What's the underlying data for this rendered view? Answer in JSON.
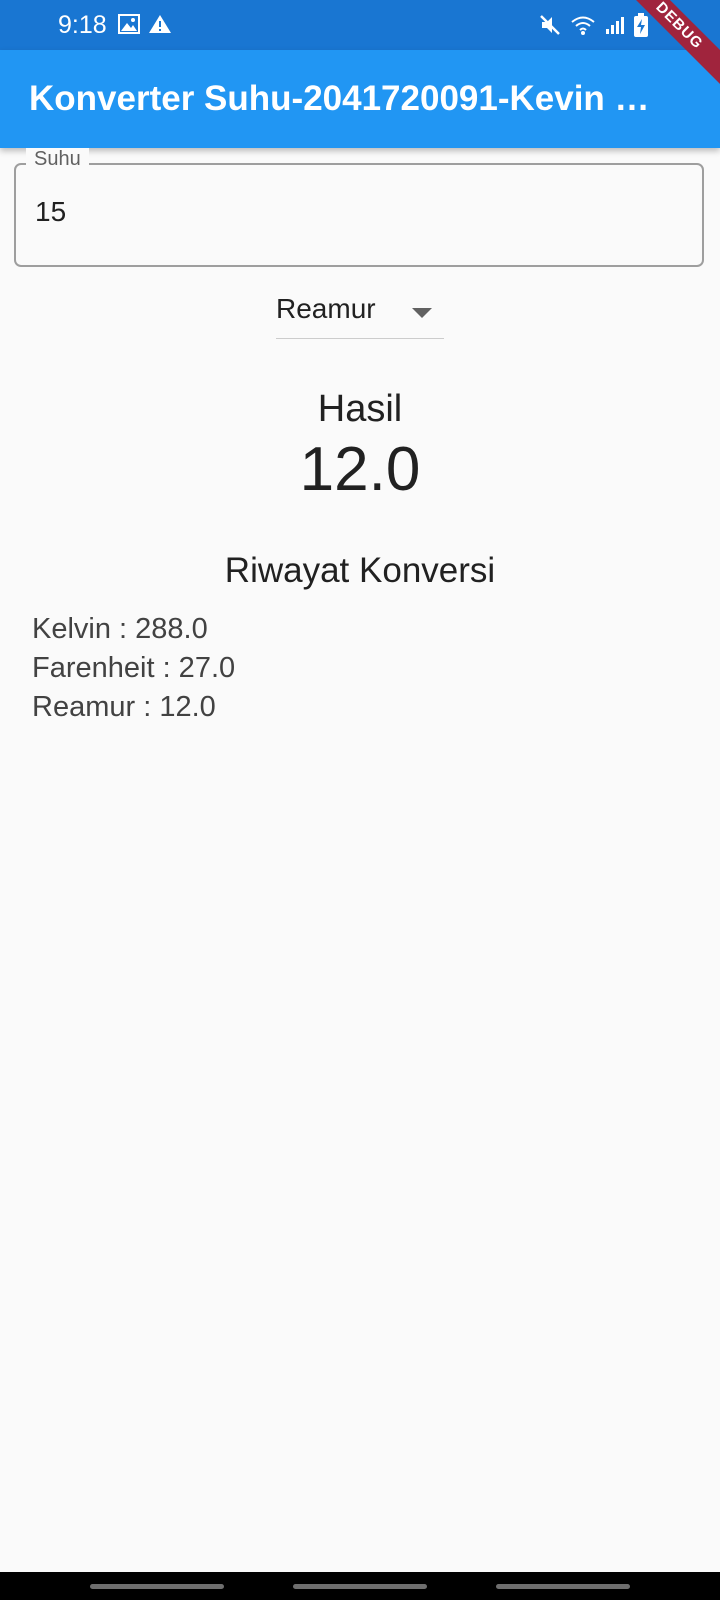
{
  "status_bar": {
    "time": "9:18",
    "left_icons": [
      "image-icon",
      "warning-icon"
    ],
    "right_icons": [
      "mute-icon",
      "wifi-icon",
      "signal-icon",
      "battery-charging-icon"
    ]
  },
  "app_bar": {
    "title": "Konverter Suhu-2041720091-Kevin …",
    "debug_label": "DEBUG"
  },
  "input": {
    "label": "Suhu",
    "value": "15"
  },
  "dropdown": {
    "selected": "Reamur"
  },
  "result": {
    "label": "Hasil",
    "value": "12.0"
  },
  "history": {
    "title": "Riwayat Konversi",
    "items": [
      "Kelvin : 288.0",
      "Farenheit : 27.0",
      "Reamur : 12.0"
    ]
  },
  "colors": {
    "status_bar": "#1976d2",
    "app_bar": "#2196f3",
    "background": "#fafafa",
    "debug_banner": "#a0243d"
  }
}
